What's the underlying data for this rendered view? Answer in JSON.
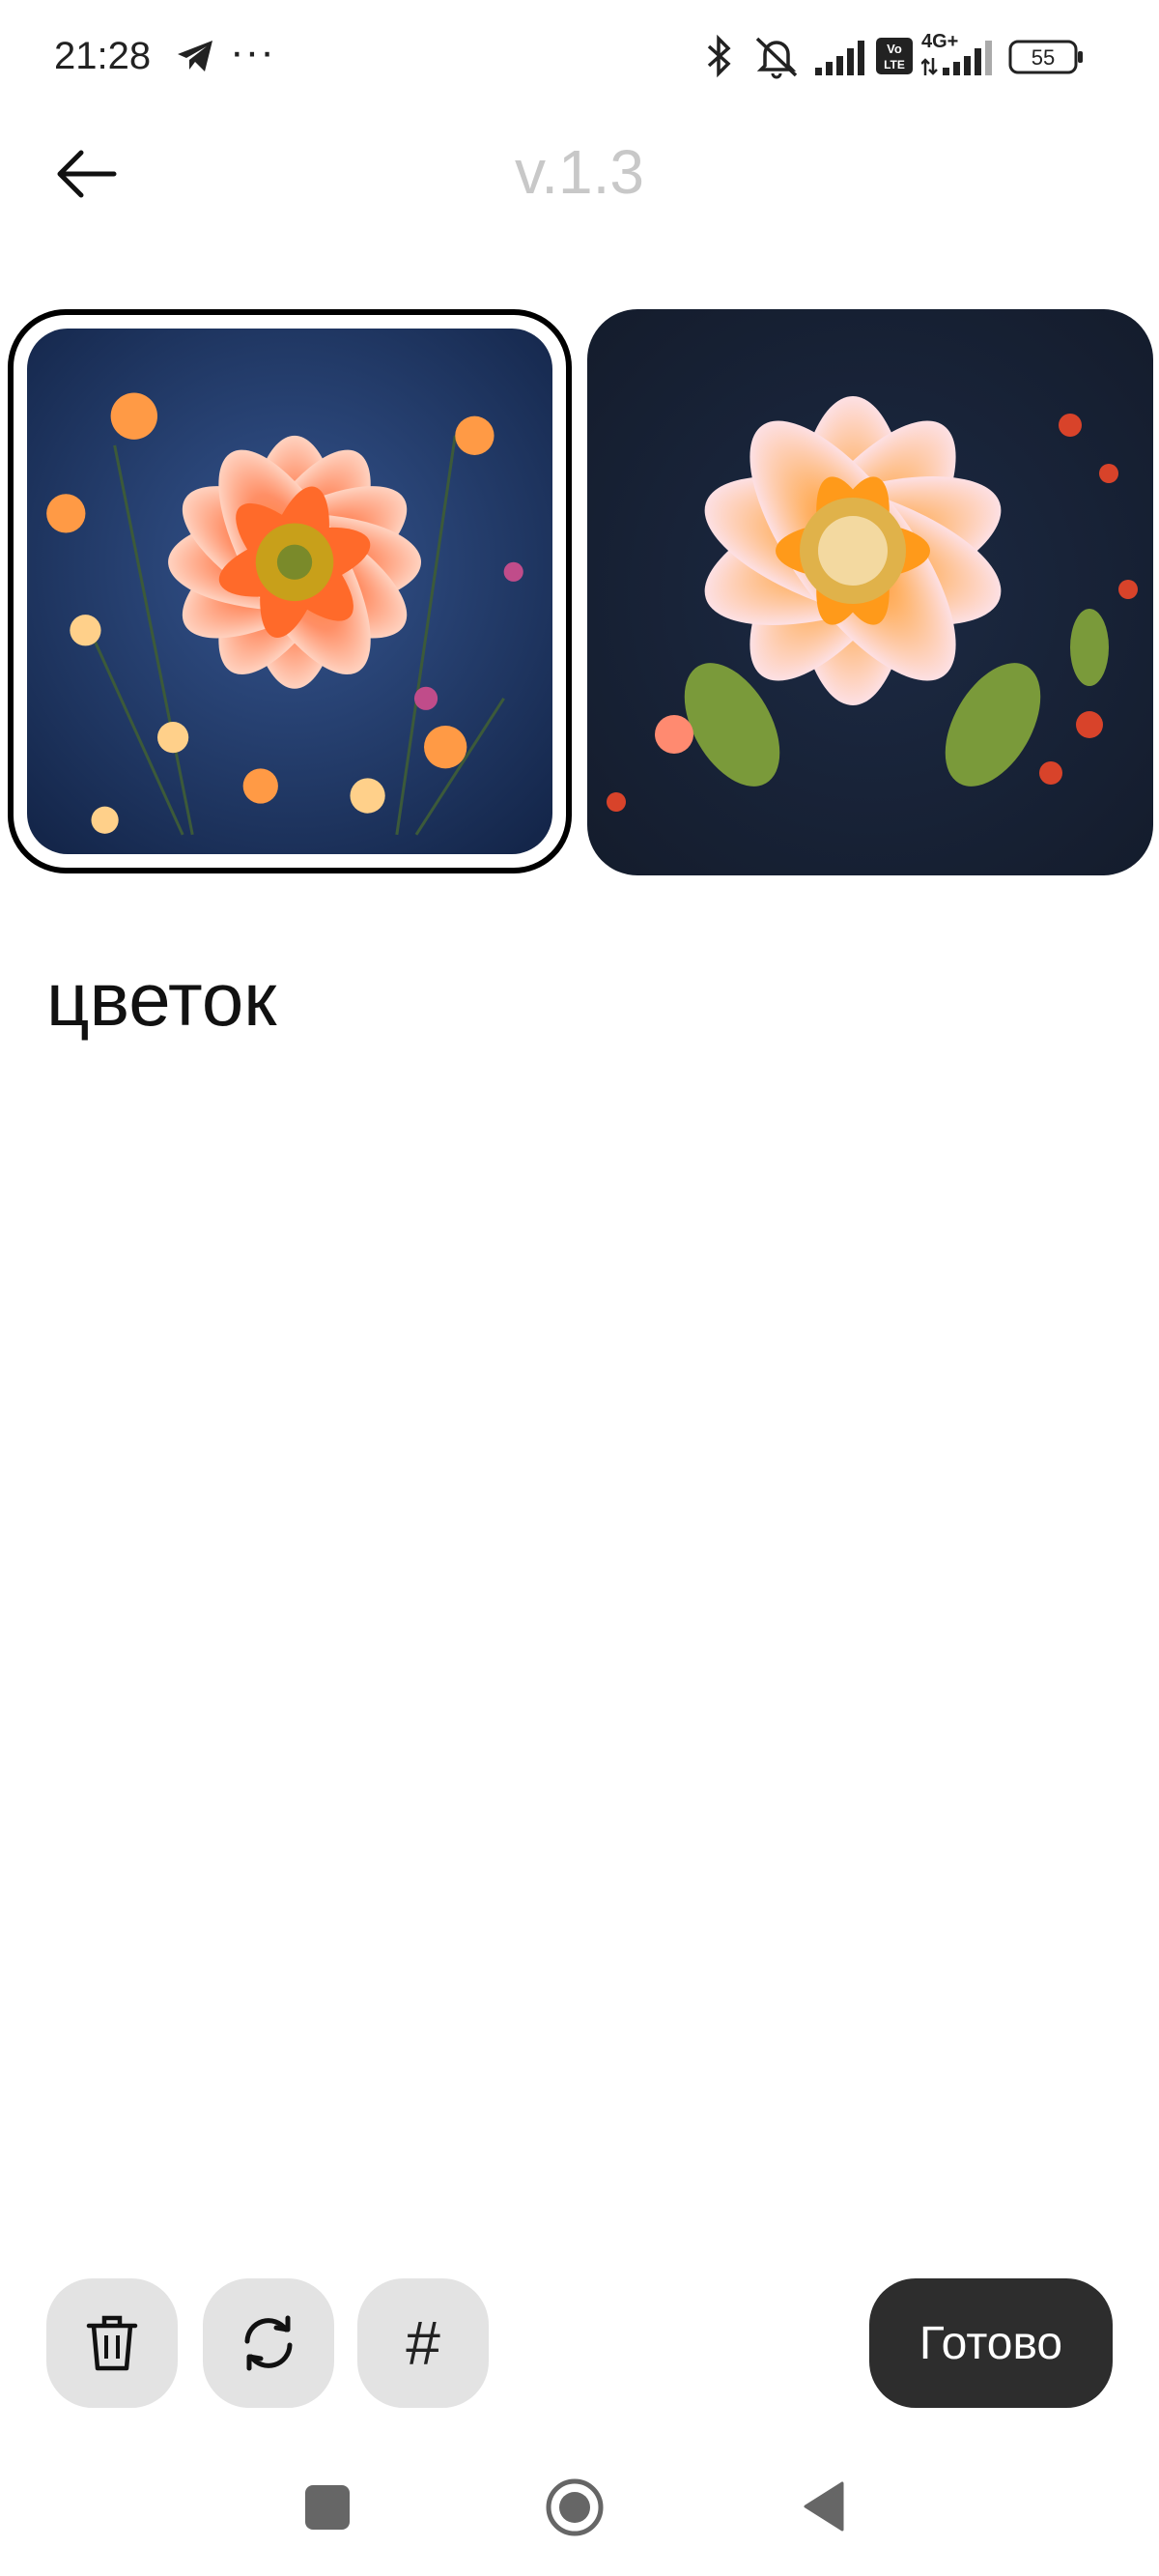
{
  "status_bar": {
    "time": "21:28",
    "more": "···",
    "network_label": "4G+",
    "volte_label": "Vo LTE",
    "battery": "55",
    "icons": [
      "telegram-icon",
      "bluetooth-icon",
      "bell-muted-icon",
      "signal-icon",
      "volte-icon",
      "signal-4g-icon",
      "battery-icon"
    ]
  },
  "header": {
    "back_icon": "arrow-left-icon",
    "version": "v.1.3"
  },
  "images": [
    {
      "name": "flower-image-1",
      "selected": true
    },
    {
      "name": "flower-image-2",
      "selected": false
    }
  ],
  "prompt": {
    "text": "цветок"
  },
  "toolbar": {
    "delete_icon": "trash-icon",
    "refresh_icon": "refresh-icon",
    "hash_label": "#",
    "done_label": "Готово"
  },
  "nav": {
    "icons": [
      "recents-icon",
      "home-icon",
      "back-triangle-icon"
    ]
  },
  "colors": {
    "version": "#c8c8c8",
    "done_bg": "#2d2d2d",
    "tool_bg": "#e3e3e3",
    "image_bg": "#1f3560"
  }
}
